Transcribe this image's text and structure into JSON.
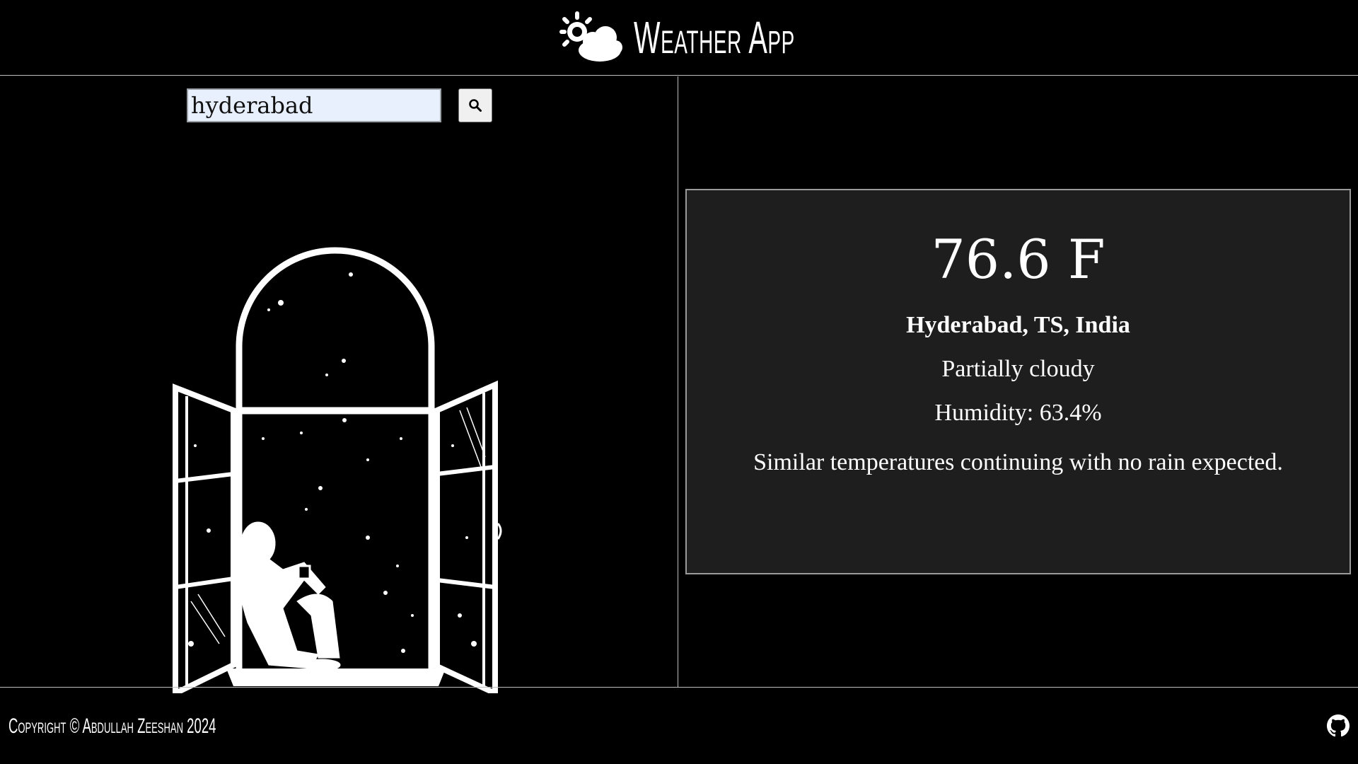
{
  "header": {
    "title": "Weather App",
    "logo_icon": "sun-cloud-icon"
  },
  "search": {
    "value": "hyderabad",
    "button_icon": "search-icon"
  },
  "weather": {
    "temperature": "76.6 F",
    "location": "Hyderabad, TS, India",
    "condition": "Partially cloudy",
    "humidity": "Humidity: 63.4%",
    "description": "Similar temperatures continuing with no rain expected."
  },
  "footer": {
    "copyright": "Copyright © Abdullah Zeeshan 2024",
    "github_icon": "github-icon"
  },
  "colors": {
    "background": "#000000",
    "card_background": "#1e1e1e",
    "card_border": "#9a9a9a",
    "input_background": "#e8f0fe"
  }
}
